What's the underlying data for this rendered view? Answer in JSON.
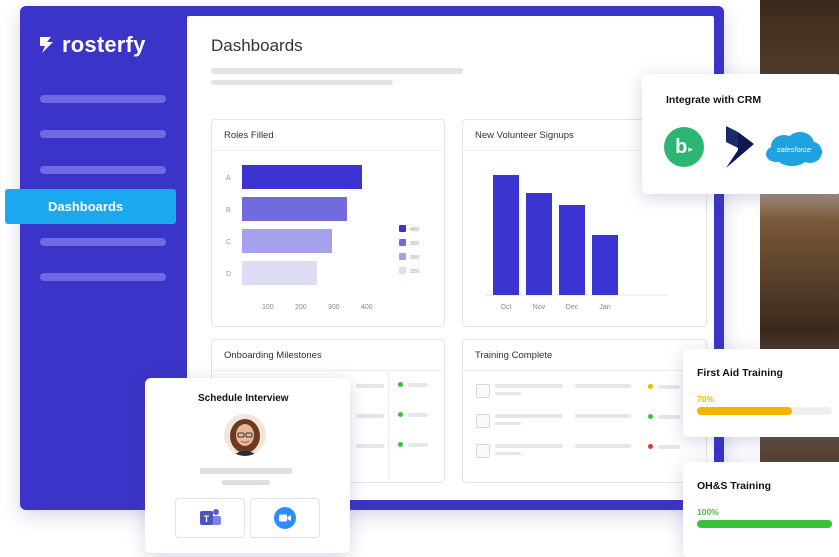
{
  "brand": {
    "name": "rosterfy"
  },
  "sidebar": {
    "active_item": "Dashboards"
  },
  "main": {
    "title": "Dashboards"
  },
  "roles_filled": {
    "title": "Roles Filled",
    "categories": [
      "A",
      "B",
      "C",
      "D"
    ],
    "values": [
      400,
      350,
      300,
      250
    ],
    "x_ticks": [
      "100",
      "200",
      "300",
      "400"
    ],
    "legend": [
      "400",
      "350",
      "300",
      "250"
    ],
    "colors": [
      "#3b34d1",
      "#716bdd",
      "#a5a1ec",
      "#dddcf5"
    ]
  },
  "volunteer_signups": {
    "title": "New Volunteer Signups",
    "categories": [
      "Oct",
      "Nov",
      "Dec",
      "Jan"
    ],
    "values": [
      1.0,
      0.85,
      0.75,
      0.5
    ],
    "color": "#3b34d1"
  },
  "onboarding": {
    "title": "Onboarding Milestones"
  },
  "training_complete": {
    "title": "Training Complete"
  },
  "crm": {
    "title": "Integrate with CRM",
    "salesforce_label": "salesforce"
  },
  "schedule": {
    "title": "Schedule Interview"
  },
  "first_aid": {
    "title": "First Aid Training",
    "percent_label": "70%",
    "progress": 0.7,
    "color": "#f5b400"
  },
  "ohs": {
    "title": "OH&S Training",
    "percent_label": "100%",
    "progress": 1.0,
    "color": "#3ac23a"
  }
}
